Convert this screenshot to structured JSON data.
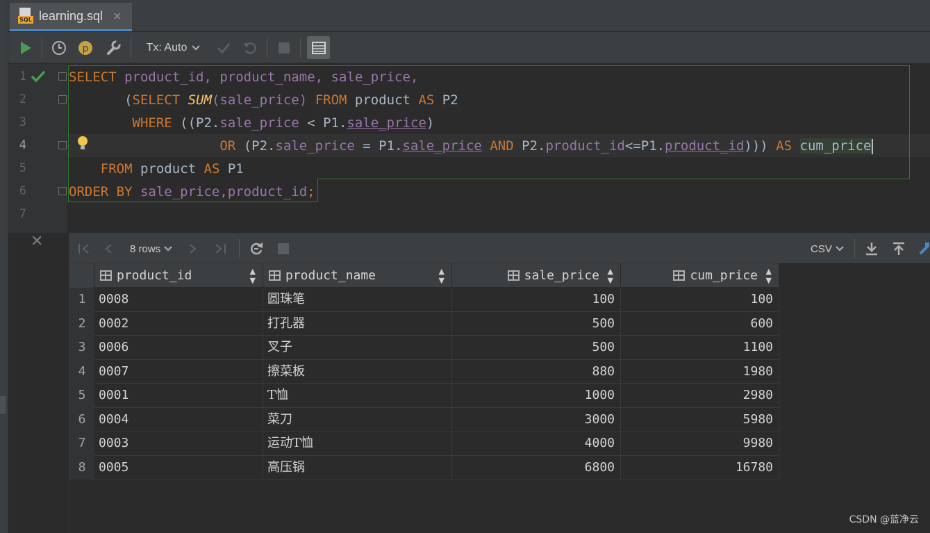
{
  "tab": {
    "title": "learning.sql",
    "close_glyph": "✕",
    "icon_text": "SQL"
  },
  "toolbar": {
    "tx_mode": "Tx: Auto",
    "profile_badge": "p"
  },
  "editor": {
    "line_numbers": [
      "1",
      "2",
      "3",
      "4",
      "5",
      "6",
      "7"
    ],
    "tokens": {
      "l1_select": "SELECT",
      "l1_cols": "product_id, product_name, sale_price,",
      "l2_open": "(",
      "l2_select": "SELECT",
      "l2_sum": "SUM",
      "l2_arg": "(sale_price)",
      "l2_from": "FROM",
      "l2_tbl": "product",
      "l2_as": "AS",
      "l2_alias": "P2",
      "l3_where": "WHERE",
      "l3_open": "((P2.",
      "l3_c1": "sale_price",
      "l3_op": " < P1.",
      "l3_c2": "sale_price",
      "l3_close": ")",
      "l4_or": "OR",
      "l4_open": "(P2.",
      "l4_c1": "sale_price",
      "l4_op": " = P1.",
      "l4_c2": "sale_price",
      "l4_and": "AND",
      "l4_p2": "P2.",
      "l4_c3": "product_id",
      "l4_le": "<=P1.",
      "l4_c4": "product_id",
      "l4_close": ")))",
      "l4_as": "AS",
      "l4_alias": "cum_price",
      "l5_from": "FROM",
      "l5_tbl": "product",
      "l5_as": "AS",
      "l5_alias": "P1",
      "l6_order": "ORDER BY",
      "l6_cols": "sale_price,product_id",
      "l6_semi": ";"
    }
  },
  "results": {
    "close_glyph": "✕",
    "row_count_label": "8 rows",
    "export_format": "CSV",
    "columns": [
      "product_id",
      "product_name",
      "sale_price",
      "cum_price"
    ],
    "rows": [
      {
        "n": "1",
        "product_id": "0008",
        "product_name": "圆珠笔",
        "sale_price": "100",
        "cum_price": "100"
      },
      {
        "n": "2",
        "product_id": "0002",
        "product_name": "打孔器",
        "sale_price": "500",
        "cum_price": "600"
      },
      {
        "n": "3",
        "product_id": "0006",
        "product_name": "叉子",
        "sale_price": "500",
        "cum_price": "1100"
      },
      {
        "n": "4",
        "product_id": "0007",
        "product_name": "擦菜板",
        "sale_price": "880",
        "cum_price": "1980"
      },
      {
        "n": "5",
        "product_id": "0001",
        "product_name": "T恤",
        "sale_price": "1000",
        "cum_price": "2980"
      },
      {
        "n": "6",
        "product_id": "0004",
        "product_name": "菜刀",
        "sale_price": "3000",
        "cum_price": "5980"
      },
      {
        "n": "7",
        "product_id": "0003",
        "product_name": "运动T恤",
        "sale_price": "4000",
        "cum_price": "9980"
      },
      {
        "n": "8",
        "product_id": "0005",
        "product_name": "高压锅",
        "sale_price": "6800",
        "cum_price": "16780"
      }
    ]
  },
  "watermark": "CSDN @蓝净云",
  "colors": {
    "keyword": "#cc7832",
    "column": "#9876aa",
    "function": "#ffc66d",
    "run_green": "#499c54",
    "selection_border": "#2f7a2f"
  }
}
